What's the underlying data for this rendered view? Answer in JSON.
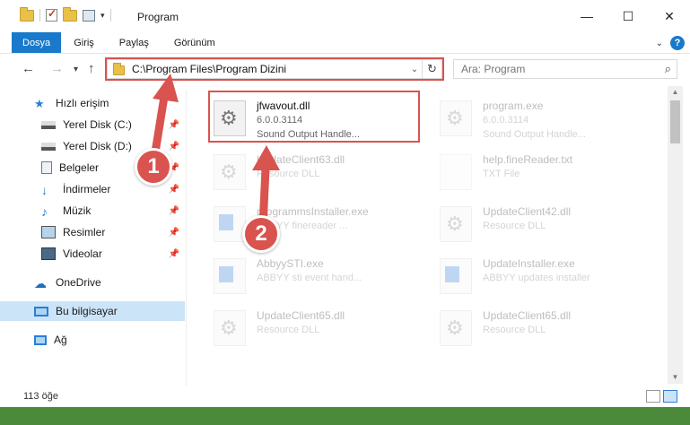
{
  "window": {
    "title": "Program"
  },
  "ribbon": {
    "tabs": [
      "Dosya",
      "Giriş",
      "Paylaş",
      "Görünüm"
    ]
  },
  "nav": {
    "path": "C:\\Program Files\\Program Dizini",
    "search_placeholder": "Ara: Program"
  },
  "sidebar": {
    "items": [
      {
        "label": "Hızlı erişim",
        "icon": "star-icon"
      },
      {
        "label": "Yerel Disk (C:)",
        "icon": "drive-icon"
      },
      {
        "label": "Yerel Disk (D:)",
        "icon": "drive-icon"
      },
      {
        "label": "Belgeler",
        "icon": "documents-icon"
      },
      {
        "label": "İndirmeler",
        "icon": "download-icon"
      },
      {
        "label": "Müzik",
        "icon": "music-icon"
      },
      {
        "label": "Resimler",
        "icon": "pictures-icon"
      },
      {
        "label": "Videolar",
        "icon": "video-icon"
      },
      {
        "label": "OneDrive",
        "icon": "cloud-icon"
      },
      {
        "label": "Bu bilgisayar",
        "icon": "computer-icon"
      },
      {
        "label": "Ağ",
        "icon": "network-icon"
      }
    ]
  },
  "files": [
    {
      "name": "jfwavout.dll",
      "line2": "6.0.0.3114",
      "line3": "Sound Output Handle...",
      "icon": "gear"
    },
    {
      "name": "program.exe",
      "line2": "6.0.0.3114",
      "line3": "Sound Output Handle...",
      "icon": "gear"
    },
    {
      "name": "UpdateClient63.dll",
      "line2": "Resource DLL",
      "line3": "",
      "icon": "gear"
    },
    {
      "name": "help.fineReader.txt",
      "line2": "TXT File",
      "line3": "",
      "icon": "txt"
    },
    {
      "name": "programmsInstaller.exe",
      "line2": "ABBYY finereader ...",
      "line3": "",
      "icon": "blue"
    },
    {
      "name": "UpdateClient42.dll",
      "line2": "Resource DLL",
      "line3": "",
      "icon": "gear"
    },
    {
      "name": "AbbyySTI.exe",
      "line2": "ABBYY sti event hand...",
      "line3": "",
      "icon": "blue"
    },
    {
      "name": "UpdateInstaller.exe",
      "line2": "ABBYY updates installer",
      "line3": "",
      "icon": "blue"
    },
    {
      "name": "UpdateClient65.dll",
      "line2": "Resource DLL",
      "line3": "",
      "icon": "gear"
    },
    {
      "name": "UpdateClient65.dll",
      "line2": "Resource DLL",
      "line3": "",
      "icon": "gear"
    }
  ],
  "status": {
    "count": "113 öğe"
  },
  "annotations": {
    "badge1": "1",
    "badge2": "2"
  },
  "colors": {
    "accent": "#1979ca",
    "highlight": "#d9534f",
    "selection": "#cce4f7"
  }
}
